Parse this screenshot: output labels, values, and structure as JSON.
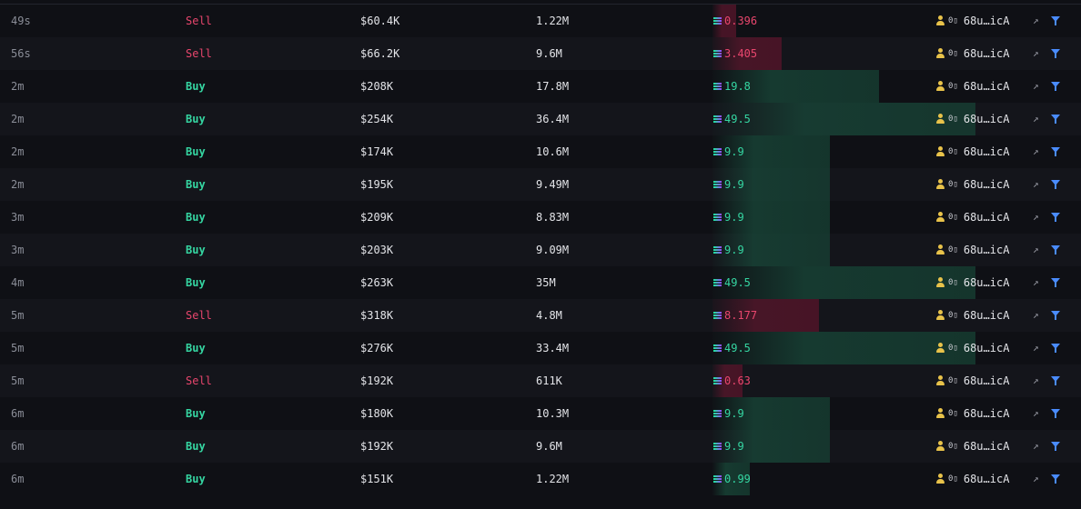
{
  "colors": {
    "buy": "#35d6a2",
    "sell": "#e8466d",
    "trader_icon": "#e8c24a",
    "filter": "#4a8cff"
  },
  "icons": {
    "token": "solana-icon",
    "trader": "user-icon",
    "link": "external-link-icon",
    "filter": "filter-icon"
  },
  "trades": [
    {
      "age": "49s",
      "type": "Sell",
      "usd": "$60.4K",
      "tokens": "1.22M",
      "sol": "0.396",
      "sol_num": 0.396,
      "trader": "68u…icA",
      "tag": "0▯"
    },
    {
      "age": "56s",
      "type": "Sell",
      "usd": "$66.2K",
      "tokens": "9.6M",
      "sol": "3.405",
      "sol_num": 3.405,
      "trader": "68u…icA",
      "tag": "0▯"
    },
    {
      "age": "2m",
      "type": "Buy",
      "usd": "$208K",
      "tokens": "17.8M",
      "sol": "19.8",
      "sol_num": 19.8,
      "trader": "68u…icA",
      "tag": "0▯"
    },
    {
      "age": "2m",
      "type": "Buy",
      "usd": "$254K",
      "tokens": "36.4M",
      "sol": "49.5",
      "sol_num": 49.5,
      "trader": "68u…icA",
      "tag": "0▯"
    },
    {
      "age": "2m",
      "type": "Buy",
      "usd": "$174K",
      "tokens": "10.6M",
      "sol": "9.9",
      "sol_num": 9.9,
      "trader": "68u…icA",
      "tag": "0▯"
    },
    {
      "age": "2m",
      "type": "Buy",
      "usd": "$195K",
      "tokens": "9.49M",
      "sol": "9.9",
      "sol_num": 9.9,
      "trader": "68u…icA",
      "tag": "0▯"
    },
    {
      "age": "3m",
      "type": "Buy",
      "usd": "$209K",
      "tokens": "8.83M",
      "sol": "9.9",
      "sol_num": 9.9,
      "trader": "68u…icA",
      "tag": "0▯"
    },
    {
      "age": "3m",
      "type": "Buy",
      "usd": "$203K",
      "tokens": "9.09M",
      "sol": "9.9",
      "sol_num": 9.9,
      "trader": "68u…icA",
      "tag": "0▯"
    },
    {
      "age": "4m",
      "type": "Buy",
      "usd": "$263K",
      "tokens": "35M",
      "sol": "49.5",
      "sol_num": 49.5,
      "trader": "68u…icA",
      "tag": "0▯"
    },
    {
      "age": "5m",
      "type": "Sell",
      "usd": "$318K",
      "tokens": "4.8M",
      "sol": "8.177",
      "sol_num": 8.177,
      "trader": "68u…icA",
      "tag": "0▯"
    },
    {
      "age": "5m",
      "type": "Buy",
      "usd": "$276K",
      "tokens": "33.4M",
      "sol": "49.5",
      "sol_num": 49.5,
      "trader": "68u…icA",
      "tag": "0▯"
    },
    {
      "age": "5m",
      "type": "Sell",
      "usd": "$192K",
      "tokens": "611K",
      "sol": "0.63",
      "sol_num": 0.63,
      "trader": "68u…icA",
      "tag": "0▯"
    },
    {
      "age": "6m",
      "type": "Buy",
      "usd": "$180K",
      "tokens": "10.3M",
      "sol": "9.9",
      "sol_num": 9.9,
      "trader": "68u…icA",
      "tag": "0▯"
    },
    {
      "age": "6m",
      "type": "Buy",
      "usd": "$192K",
      "tokens": "9.6M",
      "sol": "9.9",
      "sol_num": 9.9,
      "trader": "68u…icA",
      "tag": "0▯"
    },
    {
      "age": "6m",
      "type": "Buy",
      "usd": "$151K",
      "tokens": "1.22M",
      "sol": "0.99",
      "sol_num": 0.99,
      "trader": "68u…icA",
      "tag": "0▯"
    }
  ]
}
